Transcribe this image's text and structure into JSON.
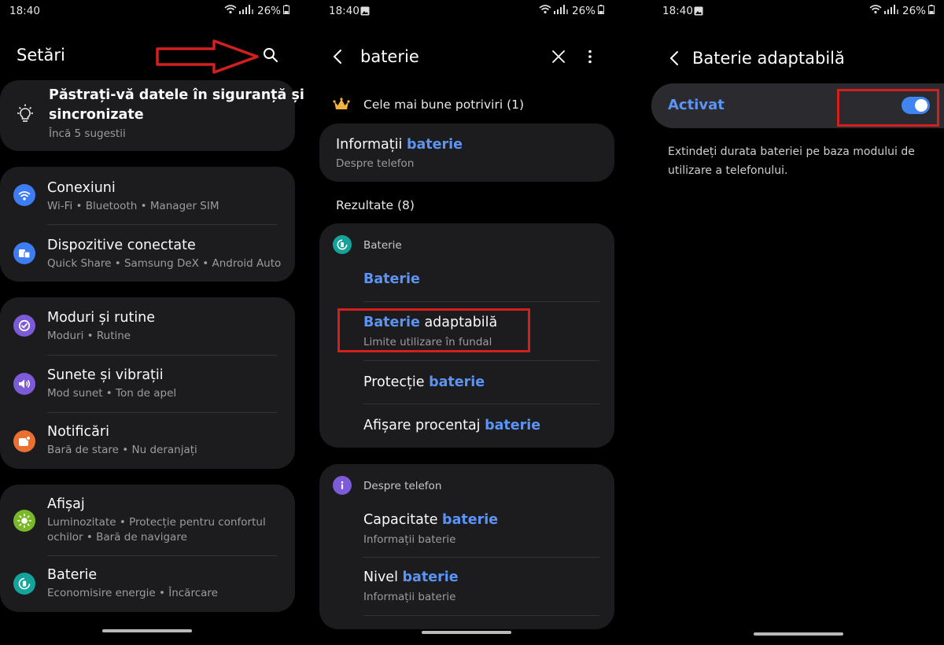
{
  "screen1": {
    "status": {
      "time": "18:40",
      "battery": "26%"
    },
    "title": "Setări",
    "suggestion": {
      "title_line1": "Păstrați-vă datele în siguranță și",
      "title_line2": "sincronizate",
      "subtitle": "Încă 5 sugestii"
    },
    "items": [
      {
        "title": "Conexiuni",
        "subtitle": "Wi-Fi  •  Bluetooth  •  Manager SIM"
      },
      {
        "title": "Dispozitive conectate",
        "subtitle": "Quick Share  •  Samsung DeX  •  Android Auto"
      },
      {
        "title": "Moduri și rutine",
        "subtitle": "Moduri  •  Rutine"
      },
      {
        "title": "Sunete și vibrații",
        "subtitle": "Mod sunet  •  Ton de apel"
      },
      {
        "title": "Notificări",
        "subtitle": "Bară de stare  •  Nu deranjați"
      },
      {
        "title": "Afișaj",
        "subtitle_line1": "Luminozitate  •  Protecție pentru confortul",
        "subtitle_line2": "ochilor  •  Bară de navigare"
      },
      {
        "title": "Baterie",
        "subtitle": "Economisire energie  •  Încărcare"
      }
    ]
  },
  "screen2": {
    "status": {
      "time": "18:40",
      "battery": "26%"
    },
    "search_query": "baterie",
    "best_matches_label": "Cele mai bune potriviri (1)",
    "best_match": {
      "title_prefix": "Informații ",
      "title_highlight": "baterie",
      "subtitle": "Despre telefon"
    },
    "results_label": "Rezultate (8)",
    "group1": {
      "header": "Baterie",
      "items": [
        {
          "highlight": "Baterie",
          "suffix": ""
        },
        {
          "highlight": "Baterie",
          "suffix": " adaptabilă",
          "subtitle": "Limite utilizare în fundal"
        },
        {
          "prefix": "Protecție ",
          "highlight": "baterie"
        },
        {
          "prefix": "Afișare procentaj ",
          "highlight": "baterie"
        }
      ]
    },
    "group2": {
      "header": "Despre telefon",
      "items": [
        {
          "prefix": "Capacitate ",
          "highlight": "baterie",
          "subtitle": "Informații baterie"
        },
        {
          "prefix": "Nivel ",
          "highlight": "baterie",
          "subtitle": "Informații baterie"
        }
      ]
    }
  },
  "screen3": {
    "status": {
      "time": "18:40",
      "battery": "26%"
    },
    "title": "Baterie adaptabilă",
    "toggle_label": "Activat",
    "toggle_on": true,
    "description_line1": "Extindeți durata bateriei pe baza modului de",
    "description_line2": "utilizare a telefonului."
  },
  "colors": {
    "accent": "#5b94f5",
    "card": "#1c1c1f",
    "highlight_box": "#d3201f"
  }
}
